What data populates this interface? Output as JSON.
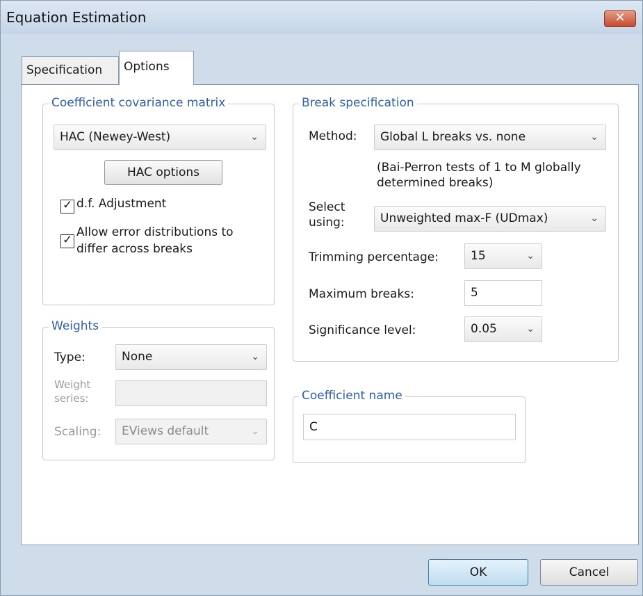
{
  "window": {
    "title": "Equation Estimation",
    "close_glyph": "✕"
  },
  "tabs": [
    {
      "label": "Specification"
    },
    {
      "label": "Options"
    }
  ],
  "covariance": {
    "group_label": "Coefficient covariance matrix",
    "method_value": "HAC (Newey-West)",
    "hac_button": "HAC options",
    "df_adjustment": {
      "label": "d.f. Adjustment",
      "checked": true
    },
    "allow_error": {
      "label_line1": "Allow error distributions to",
      "label_line2": "differ across breaks",
      "checked": true
    }
  },
  "weights": {
    "group_label": "Weights",
    "type_label": "Type:",
    "type_value": "None",
    "weight_series_label_line1": "Weight",
    "weight_series_label_line2": "series:",
    "weight_series_value": "",
    "scaling_label": "Scaling:",
    "scaling_value": "EViews default"
  },
  "breaks": {
    "group_label": "Break specification",
    "method_label": "Method:",
    "method_value": "Global L breaks vs. none",
    "note_line1": "(Bai-Perron tests of 1 to M globally",
    "note_line2": "determined breaks)",
    "select_label_line1": "Select",
    "select_label_line2": "using:",
    "select_value": "Unweighted max-F (UDmax)",
    "trimming_label": "Trimming percentage:",
    "trimming_value": "15",
    "max_breaks_label": "Maximum breaks:",
    "max_breaks_value": "5",
    "significance_label": "Significance level:",
    "significance_value": "0.05"
  },
  "coef_name": {
    "group_label": "Coefficient name",
    "value": "C"
  },
  "footer": {
    "ok": "OK",
    "cancel": "Cancel"
  },
  "icons": {
    "dropdown": "chevron-down-icon",
    "check": "checkmark-icon",
    "close": "close-icon"
  },
  "colors": {
    "group_label": "#2f5fa5",
    "dialog_bg": "#cfdcea",
    "ok_border": "#3c7fb1"
  }
}
